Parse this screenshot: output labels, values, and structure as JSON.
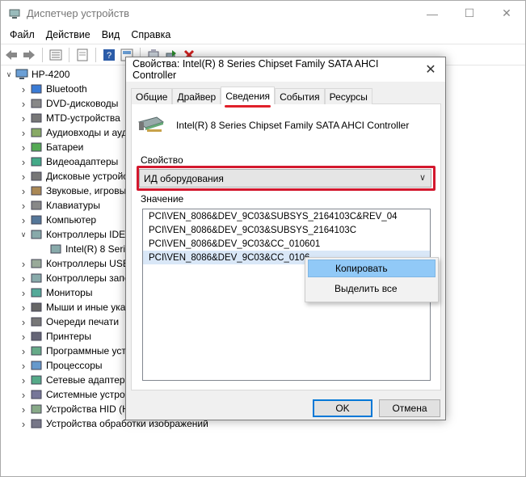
{
  "window": {
    "title": "Диспетчер устройств",
    "controls": [
      "—",
      "☐",
      "✕"
    ]
  },
  "menu": [
    "Файл",
    "Действие",
    "Вид",
    "Справка"
  ],
  "toolbar": {
    "icons": [
      "back-icon",
      "forward-icon",
      "properties-icon",
      "update-icon",
      "help-icon",
      "view-icon",
      "scan-icon",
      "enable-icon",
      "uninstall-icon"
    ]
  },
  "tree": {
    "root": "HP-4200",
    "items": [
      {
        "label": "Bluetooth",
        "icon": "bluetooth-icon",
        "expanded": false
      },
      {
        "label": "DVD-дисководы",
        "icon": "dvd-icon",
        "expanded": false
      },
      {
        "label": "MTD-устройства",
        "icon": "mtd-icon",
        "expanded": false
      },
      {
        "label": "Аудиовходы и аудиовыходы",
        "icon": "audio-icon",
        "expanded": false
      },
      {
        "label": "Батареи",
        "icon": "battery-icon",
        "expanded": false
      },
      {
        "label": "Видеоадаптеры",
        "icon": "display-adapter-icon",
        "expanded": false
      },
      {
        "label": "Дисковые устройства",
        "icon": "disk-icon",
        "expanded": false
      },
      {
        "label": "Звуковые, игровые и видеоустройства",
        "icon": "sound-icon",
        "expanded": false
      },
      {
        "label": "Клавиатуры",
        "icon": "keyboard-icon",
        "expanded": false
      },
      {
        "label": "Компьютер",
        "icon": "computer-icon",
        "expanded": false
      },
      {
        "label": "Контроллеры IDE ATA/ATAPI",
        "icon": "ide-controller-icon",
        "expanded": true
      },
      {
        "label": "Intel(R) 8 Series Chipset Family SATA AHCI Controller",
        "icon": "controller-icon",
        "child": true
      },
      {
        "label": "Контроллеры USB",
        "icon": "usb-icon",
        "expanded": false
      },
      {
        "label": "Контроллеры запоминающих устройств",
        "icon": "storage-icon",
        "expanded": false
      },
      {
        "label": "Мониторы",
        "icon": "monitor-icon",
        "expanded": false
      },
      {
        "label": "Мыши и иные указывающие устройства",
        "icon": "mouse-icon",
        "expanded": false
      },
      {
        "label": "Очереди печати",
        "icon": "print-queue-icon",
        "expanded": false
      },
      {
        "label": "Принтеры",
        "icon": "printer-icon",
        "expanded": false
      },
      {
        "label": "Программные устройства",
        "icon": "software-device-icon",
        "expanded": false
      },
      {
        "label": "Процессоры",
        "icon": "cpu-icon",
        "expanded": false
      },
      {
        "label": "Сетевые адаптеры",
        "icon": "network-icon",
        "expanded": false
      },
      {
        "label": "Системные устройства",
        "icon": "system-icon",
        "expanded": false
      },
      {
        "label": "Устройства HID (Human Interface Devices)",
        "icon": "hid-icon",
        "expanded": false
      },
      {
        "label": "Устройства обработки изображений",
        "icon": "camera-icon",
        "expanded": false
      }
    ]
  },
  "dialog": {
    "title": "Свойства: Intel(R) 8 Series Chipset Family SATA AHCI Controller",
    "close": "✕",
    "tabs": [
      "Общие",
      "Драйвер",
      "Сведения",
      "События",
      "Ресурсы"
    ],
    "active_tab": "Сведения",
    "device_name": "Intel(R) 8 Series Chipset Family SATA AHCI Controller",
    "property_label": "Свойство",
    "property_value": "ИД оборудования",
    "value_label": "Значение",
    "values": [
      "PCI\\VEN_8086&DEV_9C03&SUBSYS_2164103C&REV_04",
      "PCI\\VEN_8086&DEV_9C03&SUBSYS_2164103C",
      "PCI\\VEN_8086&DEV_9C03&CC_010601",
      "PCI\\VEN_8086&DEV_9C03&CC_0106"
    ],
    "selected_value_index": 3,
    "ok": "OK",
    "cancel": "Отмена"
  },
  "context_menu": {
    "items": [
      "Копировать",
      "Выделить все"
    ],
    "highlighted": 0
  },
  "colors": {
    "highlight_frame": "#d3182e",
    "selection": "#d9e7f7",
    "menu_highlight": "#91c9f7"
  }
}
